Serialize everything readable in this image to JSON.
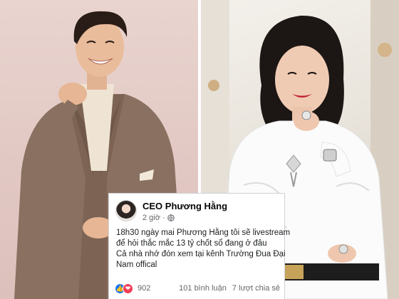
{
  "post": {
    "author": "CEO Phương Hằng",
    "time": "2 giờ",
    "body_lines": [
      "18h30 ngày mai Phương Hằng tôi sẽ livestream",
      "để hỏi thắc mắc 13 tỷ chốt sổ đang ở đâu",
      "Cả nhà nhớ đón xem tại kênh Trường Đua Đại",
      "Nam offical"
    ],
    "reactions": "902",
    "comments": "101 bình luận",
    "shares": "7 lượt chia sẻ"
  },
  "icons": {
    "globe": "globe-icon",
    "like": "like-icon",
    "love": "love-icon",
    "separator": "·"
  },
  "colors": {
    "facebook_blue": "#1877f2",
    "love_red": "#f33e58",
    "meta_gray": "#65676b",
    "left_backdrop": "#e5cbc6",
    "suit_brown": "#8a7060"
  }
}
